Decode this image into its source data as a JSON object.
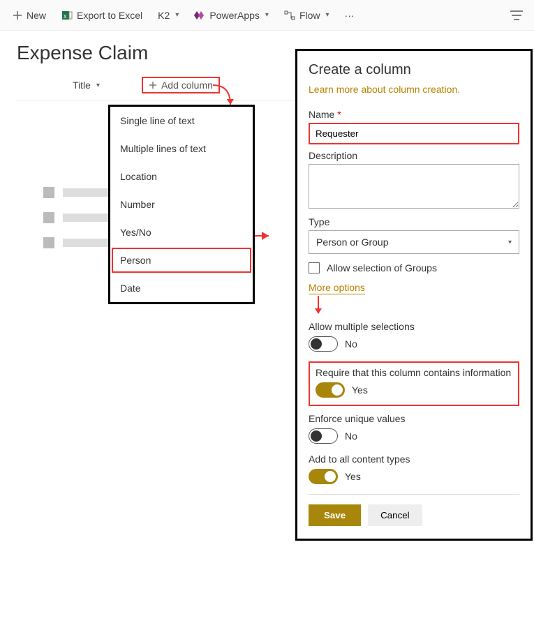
{
  "toolbar": {
    "new": "New",
    "export": "Export to Excel",
    "k2": "K2",
    "powerapps": "PowerApps",
    "flow": "Flow",
    "more": "···"
  },
  "page_title": "Expense Claim",
  "columns": {
    "title_header": "Title",
    "add_column": "Add column"
  },
  "column_menu": {
    "items": [
      "Single line of text",
      "Multiple lines of text",
      "Location",
      "Number",
      "Yes/No",
      "Person",
      "Date"
    ],
    "highlight_index": 5
  },
  "panel": {
    "title": "Create a column",
    "learn_more": "Learn more about column creation.",
    "name_label": "Name",
    "name_value": "Requester",
    "description_label": "Description",
    "description_value": "",
    "type_label": "Type",
    "type_value": "Person or Group",
    "allow_groups_label": "Allow selection of Groups",
    "more_options": "More options",
    "toggles": {
      "allow_multi": {
        "label": "Allow multiple selections",
        "on": false,
        "text": "No"
      },
      "required": {
        "label": "Require that this column contains information",
        "on": true,
        "text": "Yes"
      },
      "unique": {
        "label": "Enforce unique values",
        "on": false,
        "text": "No"
      },
      "add_ct": {
        "label": "Add to all content types",
        "on": true,
        "text": "Yes"
      }
    },
    "save": "Save",
    "cancel": "Cancel"
  }
}
